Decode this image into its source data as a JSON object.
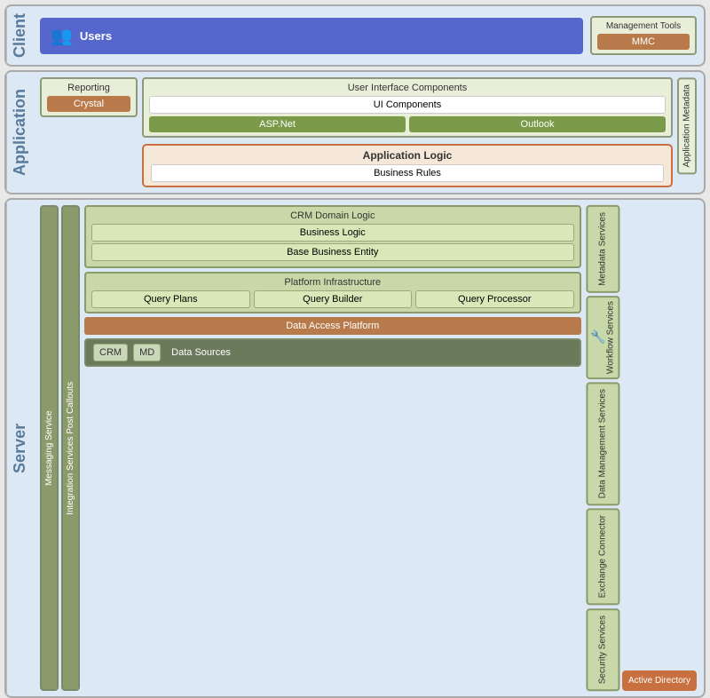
{
  "client": {
    "label": "Client",
    "users": {
      "label": "Users",
      "icon": "👥"
    },
    "management": {
      "title": "Management Tools",
      "mmc": "MMC"
    }
  },
  "application": {
    "label": "Application",
    "reporting": {
      "title": "Reporting",
      "crystal": "Crystal"
    },
    "ui_components": {
      "title": "User Interface Components",
      "ui": "UI Components",
      "aspnet": "ASP.Net",
      "outlook": "Outlook"
    },
    "app_metadata": "Application Metadata",
    "app_logic": {
      "title": "Application Logic",
      "business_rules": "Business Rules"
    }
  },
  "server": {
    "label": "Server",
    "messaging": "Messaging Service",
    "integration": "Integration Services Post Callouts",
    "crm_domain": {
      "title": "CRM Domain Logic",
      "business_logic": "Business Logic",
      "base_business": "Base Business Entity"
    },
    "platform": {
      "title": "Platform Infrastructure",
      "query_plans": "Query Plans",
      "query_builder": "Query Builder",
      "query_processor": "Query Processor"
    },
    "data_access": "Data Access Platform",
    "data_sources": {
      "label": "Data Sources",
      "crm": "CRM",
      "md": "MD"
    },
    "metadata_services": "Metadata Services",
    "workflow_services": "Workflow Services",
    "data_management": "Data Management Services",
    "exchange_connector": "Exchange Connector",
    "security_services": "Security Services",
    "active_directory": "Active Directory"
  }
}
